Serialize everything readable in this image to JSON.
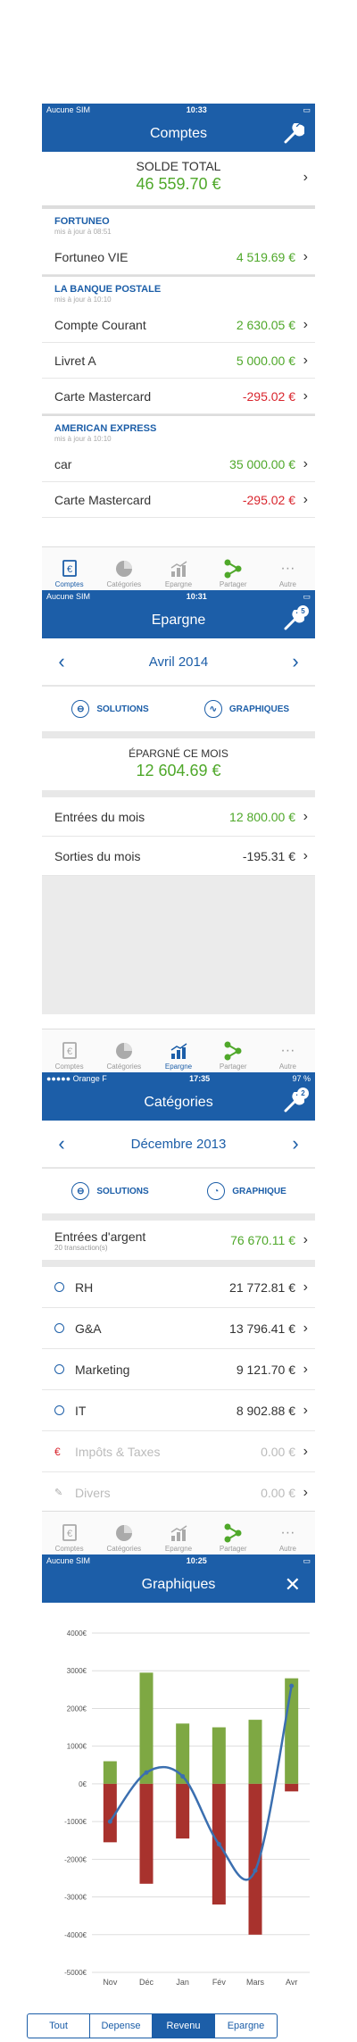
{
  "screen1": {
    "status": {
      "carrier": "Aucune SIM",
      "time": "10:33"
    },
    "title": "Comptes",
    "solde": {
      "label": "SOLDE TOTAL",
      "value": "46 559.70 €"
    },
    "banks": [
      {
        "name": "FORTUNEO",
        "updated": "mis à jour à 08:51",
        "accounts": [
          {
            "label": "Fortuneo VIE",
            "value": "4 519.69 €"
          }
        ]
      },
      {
        "name": "LA BANQUE POSTALE",
        "updated": "mis à jour à 10:10",
        "accounts": [
          {
            "label": "Compte Courant",
            "value": "2 630.05 €"
          },
          {
            "label": "Livret A",
            "value": "5 000.00 €"
          },
          {
            "label": "Carte Mastercard",
            "value": "-295.02 €"
          }
        ]
      },
      {
        "name": "AMERICAN EXPRESS",
        "updated": "mis à jour à 10:10",
        "accounts": [
          {
            "label": "car",
            "value": "35 000.00 €"
          },
          {
            "label": "Carte Mastercard",
            "value": "-295.02 €"
          }
        ]
      }
    ]
  },
  "tabs": [
    "Comptes",
    "Catégories",
    "Epargne",
    "Partager",
    "Autre"
  ],
  "screen2": {
    "status": {
      "carrier": "Aucune SIM",
      "time": "10:31"
    },
    "title": "Epargne",
    "badge": "5",
    "month": "Avril 2014",
    "btn1": "SOLUTIONS",
    "btn2": "GRAPHIQUES",
    "saved_label": "ÉPARGNÉ CE MOIS",
    "saved_value": "12 604.69 €",
    "rows": [
      {
        "label": "Entrées du mois",
        "value": "12 800.00 €"
      },
      {
        "label": "Sorties du mois",
        "value": "-195.31 €"
      }
    ]
  },
  "screen3": {
    "status": {
      "carrier": "●●●●● Orange F",
      "time": "17:35",
      "battery": "97 %"
    },
    "title": "Catégories",
    "badge": "2",
    "month": "Décembre 2013",
    "btn1": "SOLUTIONS",
    "btn2": "GRAPHIQUE",
    "income": {
      "label": "Entrées d'argent",
      "sub": "20 transaction(s)",
      "value": "76 670.11 €"
    },
    "cats": [
      {
        "label": "RH",
        "value": "21 772.81 €"
      },
      {
        "label": "G&A",
        "value": "13 796.41 €"
      },
      {
        "label": "Marketing",
        "value": "9 121.70 €"
      },
      {
        "label": "IT",
        "value": "8 902.88 €"
      },
      {
        "label": "Impôts & Taxes",
        "value": "0.00 €"
      },
      {
        "label": "Divers",
        "value": "0.00 €"
      }
    ]
  },
  "screen4": {
    "status": {
      "carrier": "Aucune SIM",
      "time": "10:25"
    },
    "title": "Graphiques",
    "segments": [
      "Tout",
      "Depense",
      "Revenu",
      "Epargne"
    ],
    "active_segment": "Revenu"
  },
  "colors": {
    "brand": "#1c5ea8",
    "positive": "#4fa82a",
    "negative": "#d9262e",
    "income_bar": "#7ea843",
    "expense_bar": "#a8322d"
  },
  "chart_data": {
    "type": "bar",
    "categories": [
      "Nov",
      "Déc",
      "Jan",
      "Fév",
      "Mars",
      "Avr"
    ],
    "series": [
      {
        "values": [
          600,
          2950,
          1600,
          1500,
          1700,
          2800
        ]
      },
      {
        "values": [
          -1550,
          -2650,
          -1450,
          -3200,
          -4000,
          -200
        ]
      },
      {
        "values": [
          -1000,
          300,
          200,
          -1600,
          -2300,
          2600
        ]
      }
    ],
    "yticks": [
      "4000€",
      "3000€",
      "2000€",
      "1000€",
      "0€",
      "-1000€",
      "-2000€",
      "-3000€",
      "-4000€",
      "-5000€"
    ],
    "ylim": [
      -5000,
      4000
    ],
    "grid": true
  }
}
